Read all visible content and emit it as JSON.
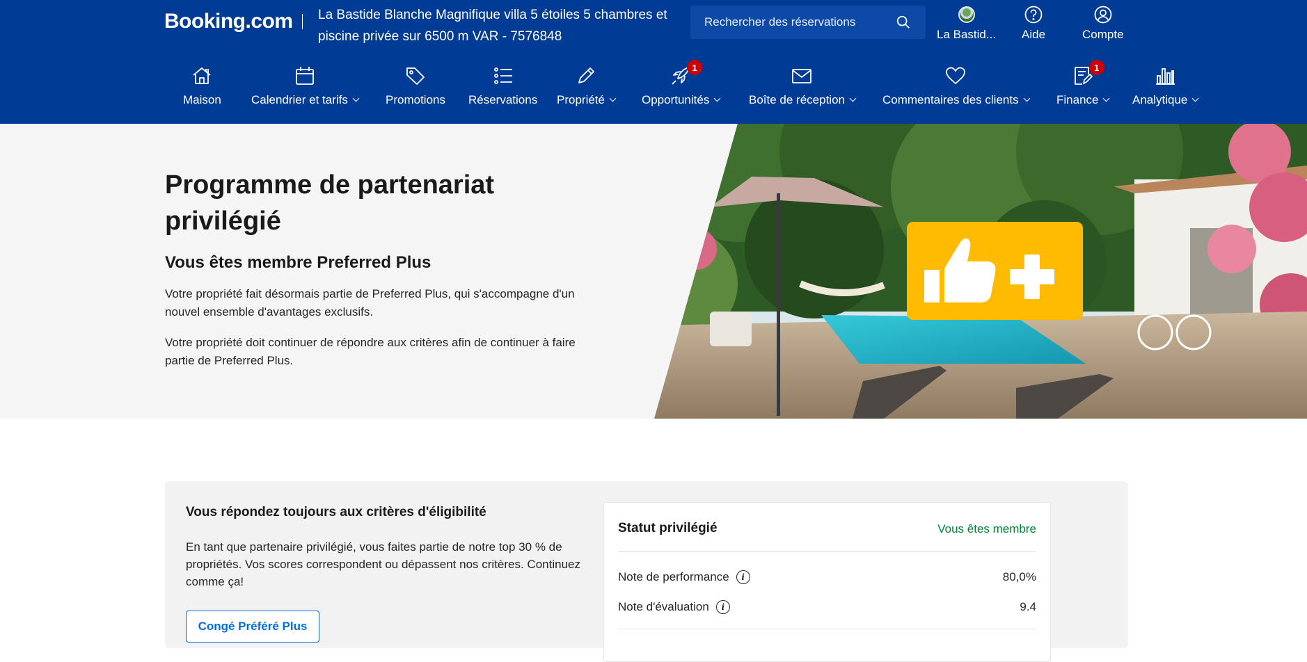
{
  "header": {
    "logo": "Booking.com",
    "property_title_line1": "La Bastide Blanche Magnifique villa 5 étoiles 5 chambres et",
    "property_title_line2": "piscine privée sur 6500 m VAR",
    "property_id": "- 7576848",
    "search_placeholder": "Rechercher des réservations",
    "property_link": "La Bastid...",
    "help_label": "Aide",
    "account_label": "Compte"
  },
  "nav": {
    "items": [
      {
        "label": "Maison",
        "icon": "home-icon",
        "dropdown": false
      },
      {
        "label": "Calendrier et tarifs",
        "icon": "calendar-icon",
        "dropdown": true
      },
      {
        "label": "Promotions",
        "icon": "tag-icon",
        "dropdown": false
      },
      {
        "label": "Réservations",
        "icon": "list-icon",
        "dropdown": false
      },
      {
        "label": "Propriété",
        "icon": "pencil-icon",
        "dropdown": true
      },
      {
        "label": "Opportunités",
        "icon": "rocket-icon",
        "dropdown": true,
        "badge": "1"
      },
      {
        "label": "Boîte de réception",
        "icon": "envelope-icon",
        "dropdown": true
      },
      {
        "label": "Commentaires des clients",
        "icon": "heart-icon",
        "dropdown": true
      },
      {
        "label": "Finance",
        "icon": "invoice-icon",
        "dropdown": true,
        "badge": "1"
      },
      {
        "label": "Analytique",
        "icon": "bar-chart-icon",
        "dropdown": true
      }
    ]
  },
  "hero": {
    "title": "Programme de partenariat privilégié",
    "subtitle": "Vous êtes membre Preferred Plus",
    "paragraph1": "Votre propriété fait désormais partie de Preferred Plus, qui s'accompagne d'un nouvel ensemble d'avantages exclusifs.",
    "paragraph2": "Votre propriété doit continuer de répondre aux critères afin de continuer à faire partie de Preferred Plus.",
    "badge_color": "#febb02"
  },
  "criteria": {
    "title": "Vous répondez toujours aux critères d'éligibilité",
    "paragraph": "En tant que partenaire privilégié, vous faites partie de notre top 30 % de propriétés. Vos scores correspondent ou dépassent nos critères. Continuez comme ça!",
    "button_label": "Congé Préféré Plus"
  },
  "status": {
    "title": "Statut privilégié",
    "member_label": "Vous êtes membre",
    "rows": [
      {
        "label": "Note de performance",
        "value": "80,0%"
      },
      {
        "label": "Note d'évaluation",
        "value": "9.4"
      }
    ]
  },
  "colors": {
    "header_bg": "#003b95",
    "accent_blue": "#006ce4",
    "member_green": "#008234",
    "badge_red": "#cc0000"
  }
}
